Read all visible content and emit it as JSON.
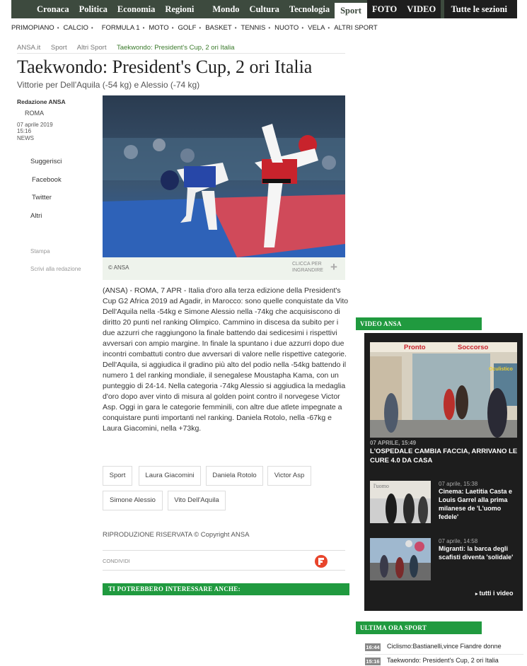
{
  "nav": {
    "main": [
      "Cronaca",
      "Politica",
      "Economia",
      "Regioni",
      "Mondo",
      "Cultura",
      "Tecnologia"
    ],
    "active": "Sport",
    "media": [
      "FOTO",
      "VIDEO"
    ],
    "all_sections": "Tutte le sezioni"
  },
  "subnav": [
    "PRIMOPIANO",
    "CALCIO",
    "FORMULA 1",
    "MOTO",
    "GOLF",
    "BASKET",
    "TENNIS",
    "NUOTO",
    "VELA",
    "ALTRI SPORT"
  ],
  "breadcrumb": [
    "ANSA.it",
    "Sport",
    "Altri Sport",
    "Taekwondo: President's Cup, 2 ori Italia"
  ],
  "article": {
    "title": "Taekwondo: President's Cup, 2 ori Italia",
    "subtitle": "Vittorie per Dell'Aquila (-54 kg) e Alessio (-74 kg)",
    "author": "Redazione ANSA",
    "location": "ROMA",
    "date": "07 aprile 2019",
    "time": "15:16",
    "category": "NEWS",
    "photo_credit": "© ANSA",
    "enlarge_label": "CLICCA PER INGRANDIRE",
    "body": "(ANSA) - ROMA, 7 APR - Italia d'oro alla terza edizione della President's Cup G2 Africa 2019 ad Agadir, in Marocco: sono quelle conquistate da Vito Dell'Aquila nella -54kg e Simone Alessio nella -74kg che acquisiscono di diritto 20 punti nel ranking Olimpico. Cammino in discesa da subito per i due azzurri che raggiungono la finale battendo dai sedicesimi i rispettivi avversari con ampio margine. In finale la spuntano i due azzurri dopo due incontri combattuti contro due avversari di valore nelle rispettive categorie. Dell'Aquila, si aggiudica il gradino più alto del podio nella -54kg battendo il numero 1 del ranking mondiale, il senegalese Moustapha Kama, con un punteggio di 24-14. Nella categoria -74kg Alessio si aggiudica la medaglia d'oro dopo aver vinto di misura al golden point contro il norvegese Victor Asp. Oggi in gara le categorie femminili, con altre due atlete impegnate a conquistare punti importanti nel ranking. Daniela Rotolo, nella -67kg e Laura Giacomini, nella +73kg.",
    "tags": [
      "Sport",
      "Laura Giacomini",
      "Daniela Rotolo",
      "Victor Asp",
      "Simone Alessio",
      "Vito Dell'Aquila"
    ],
    "copyright": "RIPRODUZIONE RISERVATA © Copyright ANSA",
    "share_label": "CONDIVIDI",
    "related_header": "TI POTREBBERO INTERESSARE ANCHE:"
  },
  "share": {
    "items": [
      "Suggerisci",
      "Facebook",
      "Twitter",
      "Altri"
    ],
    "print": "Stampa",
    "write": "Scrivi alla redazione"
  },
  "video": {
    "header": "VIDEO ANSA",
    "main": {
      "date": "07 APRILE, 15:49",
      "title": "L'OSPEDALE CAMBIA FACCIA, ARRIVANO LE CURE 4.0 DA CASA",
      "sign1": "Pronto",
      "sign2": "Soccorso",
      "sign3": "Oculistico"
    },
    "items": [
      {
        "date": "07 aprile, 15:38",
        "title": "Cinema: Laetitia Casta e Louis Garrel alla prima milanese de 'L'uomo fedele'",
        "thumb_text": "l'uomo"
      },
      {
        "date": "07 aprile, 14:58",
        "title": "Migranti: la barca degli scafisti diventa 'solidale'"
      }
    ],
    "all_link": "tutti i video"
  },
  "latest": {
    "header": "ULTIMA ORA SPORT",
    "items": [
      {
        "time": "16:44",
        "text": "Ciclismo:Bastianelli,vince Fiandre donne"
      },
      {
        "time": "15:16",
        "text": "Taekwondo: President's Cup, 2 ori Italia"
      }
    ]
  },
  "colors": {
    "nav_bg": "#3d4a3e",
    "accent_green": "#209a3f",
    "video_bg": "#1d1d1d",
    "share_red": "#e8452c"
  }
}
